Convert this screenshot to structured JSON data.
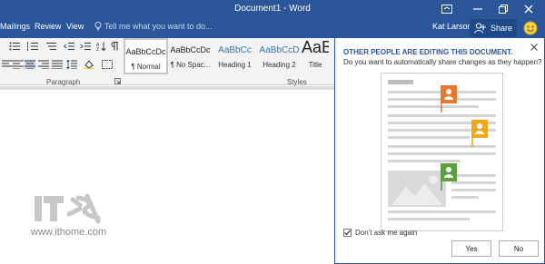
{
  "window": {
    "title": "Document1 - Word"
  },
  "tabs": [
    {
      "label": "Mailings"
    },
    {
      "label": "Review"
    },
    {
      "label": "View"
    }
  ],
  "tell_me": {
    "placeholder": "Tell me what you want to do..."
  },
  "user": {
    "name": "Kat Larson"
  },
  "share": {
    "label": "Share"
  },
  "ribbon": {
    "groups": {
      "paragraph": "Paragraph",
      "styles": "Styles"
    },
    "styles": [
      {
        "sample": "AaBbCcDc",
        "name": "¶ Normal"
      },
      {
        "sample": "AaBbCcDc",
        "name": "¶ No Spac..."
      },
      {
        "sample": "AaBbCc",
        "name": "Heading 1"
      },
      {
        "sample": "AaBbCcD",
        "name": "Heading 2"
      },
      {
        "sample": "AaB",
        "name": "Title"
      }
    ]
  },
  "notification": {
    "title": "OTHER PEOPLE ARE EDITING THIS DOCUMENT.",
    "message": "Do you want to automatically share changes as they happen?",
    "checkbox_label": "Don't ask me again",
    "checkbox_checked": true,
    "yes_label": "Yes",
    "no_label": "No"
  },
  "watermark": {
    "logo_text": "IT之家",
    "url": "www.ithome.com"
  },
  "colors": {
    "word_blue": "#2b579a",
    "ribbon_bg": "#f3f3f3",
    "flag_orange": "#e8782a",
    "flag_yellow": "#f0a818",
    "flag_green": "#5aa03c"
  }
}
